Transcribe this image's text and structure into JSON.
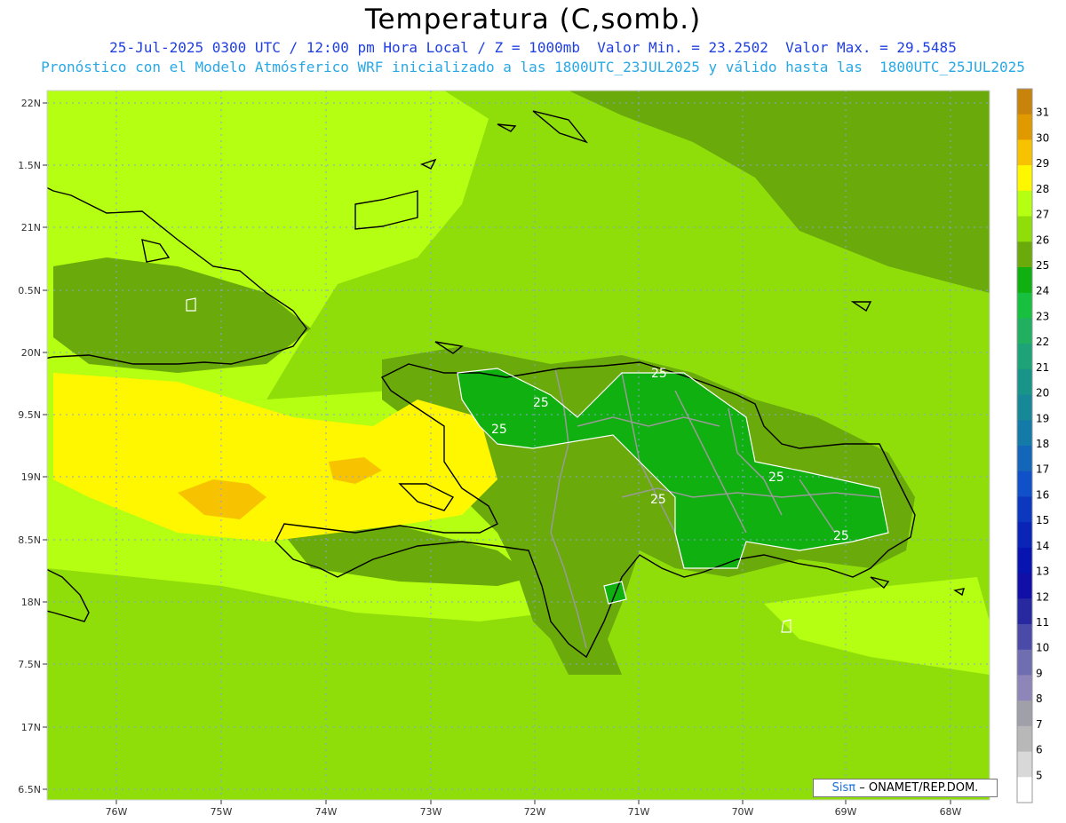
{
  "header": {
    "title": "Temperatura (C,somb.)",
    "subtitle1": "25-Jul-2025 0300 UTC / 12:00 pm Hora Local / Z = 1000mb  Valor Min. = 23.2502  Valor Max. = 29.5485",
    "subtitle2": "Pronóstico con el Modelo Atmósferico WRF inicializado a las 1800UTC_23JUL2025 y válido hasta las  1800UTC_25JUL2025"
  },
  "axes": {
    "lon_labels": [
      "76W",
      "75W",
      "74W",
      "73W",
      "72W",
      "71W",
      "70W",
      "69W",
      "68W"
    ],
    "lat_labels": [
      "22N",
      "1.5N",
      "21N",
      "0.5N",
      "20N",
      "9.5N",
      "19N",
      "8.5N",
      "18N",
      "7.5N",
      "17N",
      "6.5N"
    ]
  },
  "contour_labels": [
    "25",
    "25",
    "25",
    "25",
    "25",
    "25"
  ],
  "colorbar": {
    "labels": [
      "31",
      "30",
      "29",
      "28",
      "27",
      "26",
      "25",
      "24",
      "23",
      "22",
      "21",
      "20",
      "19",
      "18",
      "17",
      "16",
      "15",
      "14",
      "13",
      "12",
      "11",
      "10",
      "9",
      "8",
      "7",
      "6",
      "5"
    ],
    "colors": [
      "#c8830a",
      "#e09a00",
      "#f7c200",
      "#fff700",
      "#b4ff12",
      "#8fde0a",
      "#6aaa0a",
      "#10b010",
      "#18c040",
      "#20b060",
      "#1ea278",
      "#199488",
      "#168898",
      "#147aa8",
      "#1366b8",
      "#1050c8",
      "#0c38c0",
      "#0a24b8",
      "#0814b0",
      "#1010a8",
      "#2828a0",
      "#4a4aa8",
      "#6e6eb0",
      "#8e86b8",
      "#a0a0a8",
      "#b8b8b8",
      "#d8d8d8",
      "#ffffff"
    ]
  },
  "credit": {
    "sis": "Sisπ",
    "rest": "– ONAMET/REP.DOM."
  }
}
